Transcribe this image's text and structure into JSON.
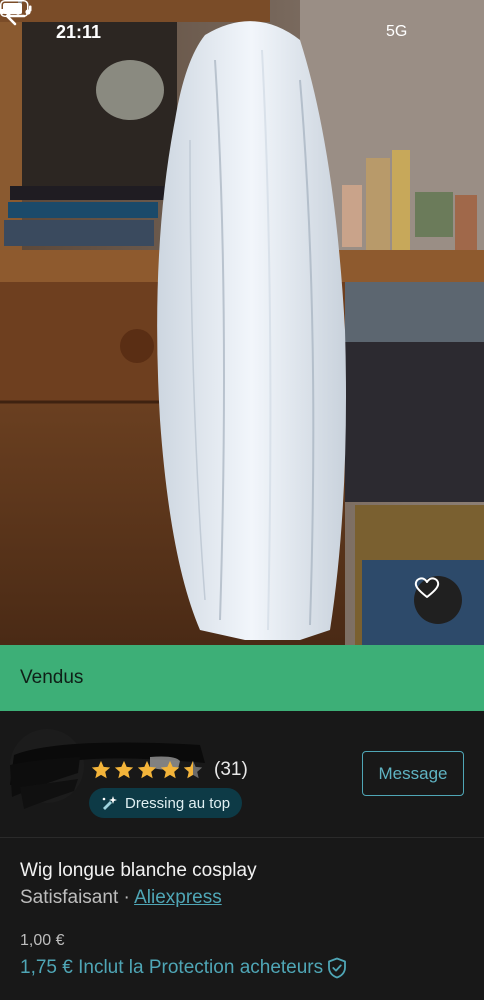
{
  "status_bar": {
    "time": "21:11",
    "network": "5G"
  },
  "photo": {
    "icons": {
      "back": "arrow-left-icon",
      "more": "more-horizontal-icon",
      "favorite": "heart-icon"
    }
  },
  "banner": {
    "label": "Vendus",
    "color": "#3daf77"
  },
  "seller": {
    "rating_stars": 4.5,
    "review_count": "(31)",
    "badge_label": "Dressing au top",
    "message_label": "Message"
  },
  "item": {
    "title": "Wig longue blanche cosplay",
    "condition": "Satisfaisant",
    "separator": " · ",
    "brand": "Aliexpress",
    "price": "1,00 €",
    "total_price": "1,75 € Inclut la Protection acheteurs"
  },
  "colors": {
    "accent": "#4fa6b6",
    "background": "#181818",
    "star": "#f3b43a"
  }
}
